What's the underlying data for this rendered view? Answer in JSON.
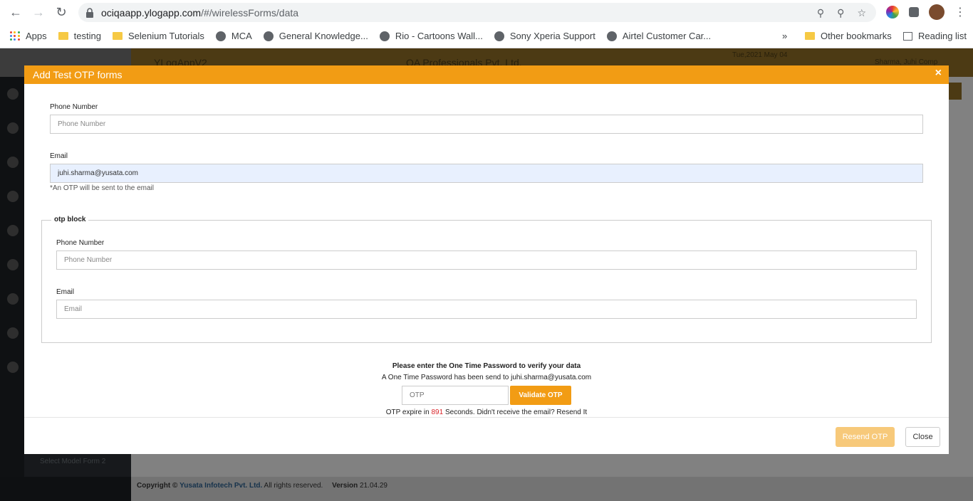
{
  "browser": {
    "url_host": "ociqaapp.ylogapp.com",
    "url_path": "/#/wirelessForms/data",
    "bookmarks": [
      {
        "label": "Apps",
        "icon": "apps-grid-icon"
      },
      {
        "label": "testing",
        "icon": "folder-icon"
      },
      {
        "label": "Selenium Tutorials",
        "icon": "folder-icon"
      },
      {
        "label": "MCA",
        "icon": "globe-icon"
      },
      {
        "label": "General Knowledge...",
        "icon": "globe-icon"
      },
      {
        "label": "Rio - Cartoons Wall...",
        "icon": "globe-icon"
      },
      {
        "label": "Sony Xperia Support",
        "icon": "globe-icon"
      },
      {
        "label": "Airtel Customer Car...",
        "icon": "globe-icon"
      }
    ],
    "other_bookmarks": "Other bookmarks",
    "reading_list": "Reading list",
    "overflow": "»"
  },
  "app": {
    "title": "YLogAppV2",
    "org": "QA Professionals Pvt. Ltd.",
    "date": "Tue,2021 May 04",
    "user": "Sharma, Juhi Comp",
    "sidebar_items": [
      "Select Model Form 2"
    ],
    "footer": {
      "copyright": "Copyright ©",
      "company": "Yusata Infotech Pvt. Ltd.",
      "rights": "All rights reserved.",
      "version_label": "Version",
      "version": "21.04.29"
    }
  },
  "modal": {
    "title": "Add Test OTP forms",
    "close_icon": "×",
    "phone_label": "Phone Number",
    "phone_placeholder": "Phone Number",
    "email_label": "Email",
    "email_value": "juhi.sharma@yusata.com",
    "email_hint": "*An OTP will be sent to the email",
    "otp_block": {
      "legend": "otp block",
      "phone_label": "Phone Number",
      "phone_placeholder": "Phone Number",
      "email_label": "Email",
      "email_placeholder": "Email"
    },
    "otp_prompt": "Please enter the One Time Password to verify your data",
    "otp_sent": "A One Time Password has been send to juhi.sharma@yusata.com",
    "otp_placeholder": "OTP",
    "validate_label": "Validate OTP",
    "expire_prefix": "OTP expire in",
    "expire_seconds": "891",
    "expire_suffix": "Seconds. Didn't receive the email? Resend It",
    "resend_label": "Resend OTP",
    "close_label": "Close"
  },
  "colors": {
    "accent": "#f29c14",
    "accent_disabled": "#f7c97a",
    "seconds": "#d9262b"
  }
}
